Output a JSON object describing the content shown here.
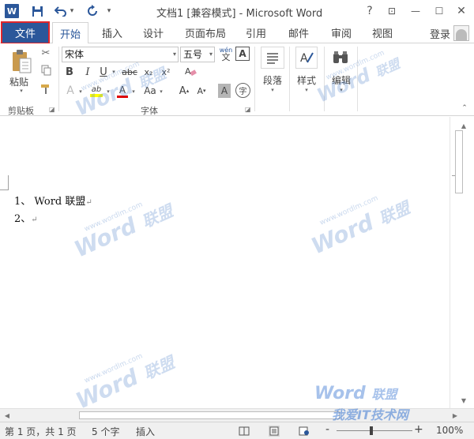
{
  "titlebar": {
    "app_icon": "W",
    "title": "文档1 [兼容模式] - Microsoft Word",
    "help": "?",
    "ribbon_display": "⊡",
    "minimize": "—",
    "restore": "☐",
    "close": "✕"
  },
  "tabs": {
    "file": "文件",
    "items": [
      "开始",
      "插入",
      "设计",
      "页面布局",
      "引用",
      "邮件",
      "审阅",
      "视图"
    ],
    "login": "登录"
  },
  "ribbon": {
    "clipboard": {
      "paste": "粘贴",
      "label": "剪贴板"
    },
    "font": {
      "font_name": "宋体",
      "font_size": "五号",
      "phonetic_top": "wén",
      "phonetic_bottom": "文",
      "char_border": "A",
      "bold": "B",
      "italic": "I",
      "underline": "U",
      "strike": "abc",
      "subscript": "x₂",
      "superscript": "x²",
      "text_effect": "A",
      "highlight": "ab",
      "font_color": "A",
      "change_case": "Aa",
      "grow": "A",
      "shrink": "A",
      "char_shading": "A",
      "enclose": "字",
      "label": "字体"
    },
    "paragraph": {
      "label": "段落"
    },
    "styles": {
      "label": "样式"
    },
    "editing": {
      "label": "编辑"
    }
  },
  "document": {
    "lines": [
      "1、 Word 联盟",
      "2、"
    ]
  },
  "statusbar": {
    "page": "第 1 页，共 1 页",
    "words": "5 个字",
    "mode": "插入",
    "zoom_minus": "-",
    "zoom_plus": "+",
    "zoom": "100%",
    "zoom_level": 1.0
  },
  "watermark": {
    "brand": "Word",
    "brand_cn": "联盟",
    "url": "www.wordlm.com",
    "site": "我爱IT技术网"
  },
  "colors": {
    "accent": "#2b579a",
    "file_outline": "#e0262b",
    "highlight_yellow": "#ffff00",
    "font_red": "#e00000"
  }
}
